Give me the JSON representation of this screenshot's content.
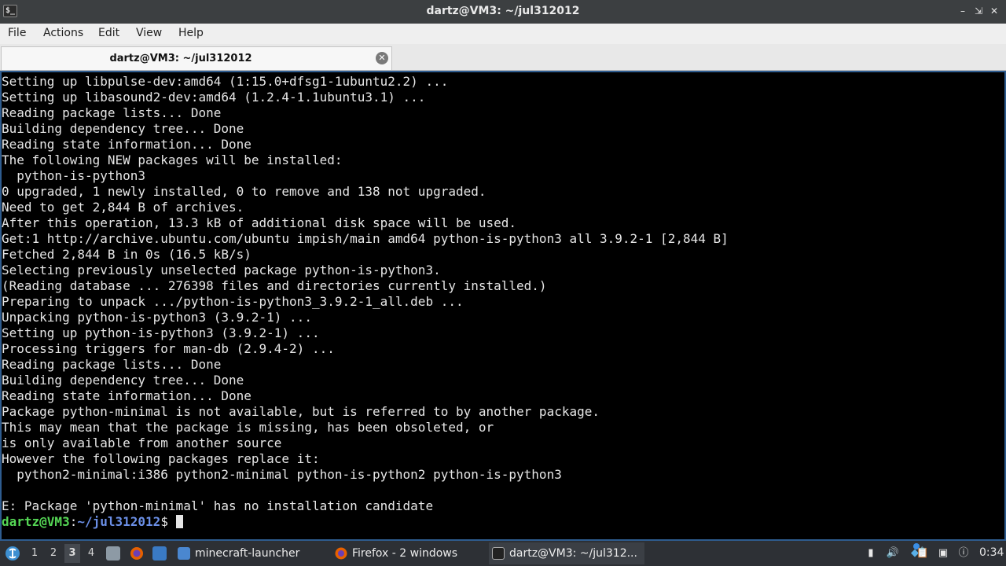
{
  "window": {
    "title": "dartz@VM3: ~/jul312012",
    "icon_label": "$_"
  },
  "menubar": {
    "items": [
      "File",
      "Actions",
      "Edit",
      "View",
      "Help"
    ]
  },
  "tabs": [
    {
      "label": "dartz@VM3: ~/jul312012",
      "active": true
    }
  ],
  "terminal": {
    "lines": [
      "Setting up libpulse-dev:amd64 (1:15.0+dfsg1-1ubuntu2.2) ...",
      "Setting up libasound2-dev:amd64 (1.2.4-1.1ubuntu3.1) ...",
      "Reading package lists... Done",
      "Building dependency tree... Done",
      "Reading state information... Done",
      "The following NEW packages will be installed:",
      "  python-is-python3",
      "0 upgraded, 1 newly installed, 0 to remove and 138 not upgraded.",
      "Need to get 2,844 B of archives.",
      "After this operation, 13.3 kB of additional disk space will be used.",
      "Get:1 http://archive.ubuntu.com/ubuntu impish/main amd64 python-is-python3 all 3.9.2-1 [2,844 B]",
      "Fetched 2,844 B in 0s (16.5 kB/s)",
      "Selecting previously unselected package python-is-python3.",
      "(Reading database ... 276398 files and directories currently installed.)",
      "Preparing to unpack .../python-is-python3_3.9.2-1_all.deb ...",
      "Unpacking python-is-python3 (3.9.2-1) ...",
      "Setting up python-is-python3 (3.9.2-1) ...",
      "Processing triggers for man-db (2.9.4-2) ...",
      "Reading package lists... Done",
      "Building dependency tree... Done",
      "Reading state information... Done",
      "Package python-minimal is not available, but is referred to by another package.",
      "This may mean that the package is missing, has been obsoleted, or",
      "is only available from another source",
      "However the following packages replace it:",
      "  python2-minimal:i386 python2-minimal python-is-python2 python-is-python3",
      "",
      "E: Package 'python-minimal' has no installation candidate"
    ],
    "prompt": {
      "user_host": "dartz@VM3",
      "separator": ":",
      "path": "~/jul312012",
      "symbol": "$ "
    }
  },
  "taskbar": {
    "workspaces": [
      "1",
      "2",
      "3",
      "4"
    ],
    "active_workspace": "3",
    "tasks": [
      {
        "label": "minecraft-launcher",
        "icon": "folder-icon"
      },
      {
        "label": "Firefox - 2 windows",
        "icon": "firefox-icon"
      },
      {
        "label": "dartz@VM3: ~/jul312...",
        "icon": "terminal-icon",
        "active": true
      }
    ],
    "clock": "0:34"
  },
  "colors": {
    "prompt_user": "#55d655",
    "prompt_path": "#6b8fe6",
    "terminal_bg": "#000000",
    "terminal_fg": "#e6e6e6",
    "taskbar_bg": "#2d3035",
    "titlebar_bg": "#3c3f41"
  }
}
